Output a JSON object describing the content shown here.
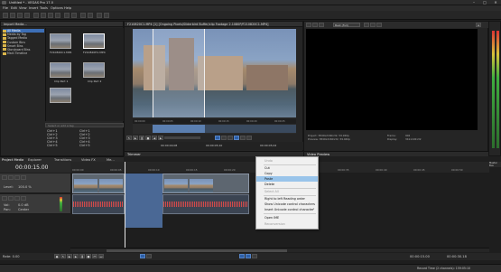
{
  "window": {
    "title": "Untitled * - VEGAS Pro 17.0",
    "min": "–",
    "max": "□",
    "close": "✕"
  },
  "menu": [
    "File",
    "Edit",
    "View",
    "Insert",
    "Tools",
    "Options",
    "Help"
  ],
  "project_media": {
    "tree_root": "All Media",
    "tree_items": [
      "Media by Tag",
      "Tagged Media",
      "Custom Bins",
      "Smart Bins",
      "Storyboard Bins",
      "Main Timeline"
    ],
    "thumbs": [
      {
        "label": "F210820C1.MP4"
      },
      {
        "label": "F210820H1.MP4"
      },
      {
        "label": "Clip Part 1"
      },
      {
        "label": "Clip Part 2"
      }
    ],
    "tag_placeholder": "Select or add a tag",
    "shortcuts": [
      {
        "key": "Ctrl+1",
        "tag": "Ctrl+1"
      },
      {
        "key": "Ctrl+2",
        "tag": "Ctrl+2"
      },
      {
        "key": "Ctrl+3",
        "tag": "Ctrl+3"
      },
      {
        "key": "Ctrl+4",
        "tag": "Ctrl+4"
      },
      {
        "key": "Ctrl+5",
        "tag": "Ctrl+5"
      }
    ],
    "tabs": [
      "Project Media",
      "Explorer",
      "Transitions",
      "Video FX",
      "Me..."
    ]
  },
  "trimmer": {
    "title": "F210820C1.MP4  [1] [Ongoing Pixels/Sliderbird Buffer/clip Footage 2.1080P/F210820C1.MP4]",
    "tab": "Trimmer",
    "timecodes": [
      "00:00:00",
      "00:00:05",
      "00:00:10",
      "00:00:15",
      "00:00:20",
      "00:00:25"
    ],
    "in_time": "00:00:00;08",
    "out_time": "00:00:05;10",
    "length": "00:00:05;02"
  },
  "preview": {
    "quality": "Best (Full)",
    "project_info": "Project: 3840x2160x32, 59.940p",
    "preview_info": "Preview: 3840x2160x32, 59.940p",
    "frame_label": "Frame:",
    "frame_value": "902",
    "display_label": "Display:",
    "display_value": "341x192x32",
    "tab": "Video Preview"
  },
  "timeline": {
    "position": "00:00:15.00",
    "ruler": [
      "00:00:00",
      "00:00:05",
      "00:00:10",
      "00:00:15",
      "00:00:20",
      "00:00:25",
      "00:00:30",
      "00:00:35",
      "00:00:40",
      "00:00:45",
      "00:00:50"
    ],
    "tracks": [
      {
        "name": "Level:",
        "value": "100.0 %"
      },
      {
        "name": "Vol:",
        "value": "0.0 dB"
      },
      {
        "name": "Pan:",
        "value": "Center"
      }
    ],
    "master_tab": "Master Bus",
    "rate": "Rate: 0.00",
    "end_time": "00:00:15.00",
    "end_time2": "00:00:30.18"
  },
  "context_menu": {
    "items": [
      {
        "label": "Undo",
        "disabled": true
      },
      {
        "sep": true
      },
      {
        "label": "Cut",
        "disabled": false
      },
      {
        "label": "Copy",
        "disabled": false
      },
      {
        "label": "Paste",
        "disabled": false,
        "highlighted": true
      },
      {
        "label": "Delete",
        "disabled": false
      },
      {
        "sep": true
      },
      {
        "label": "Select All",
        "disabled": true
      },
      {
        "sep": true
      },
      {
        "label": "Right to left Reading order",
        "disabled": false
      },
      {
        "label": "Show Unicode control characters",
        "disabled": false
      },
      {
        "label": "Insert Unicode control character",
        "disabled": false,
        "submenu": true
      },
      {
        "sep": true
      },
      {
        "label": "Open IME",
        "disabled": false
      },
      {
        "label": "Reconversion",
        "disabled": true
      }
    ]
  },
  "status": {
    "record_time": "Record Time (2 channels): 159:05:10"
  },
  "colors": {
    "accent": "#2d5fa8",
    "selection": "#5b7fb0",
    "menu_highlight": "#99c4ea"
  }
}
